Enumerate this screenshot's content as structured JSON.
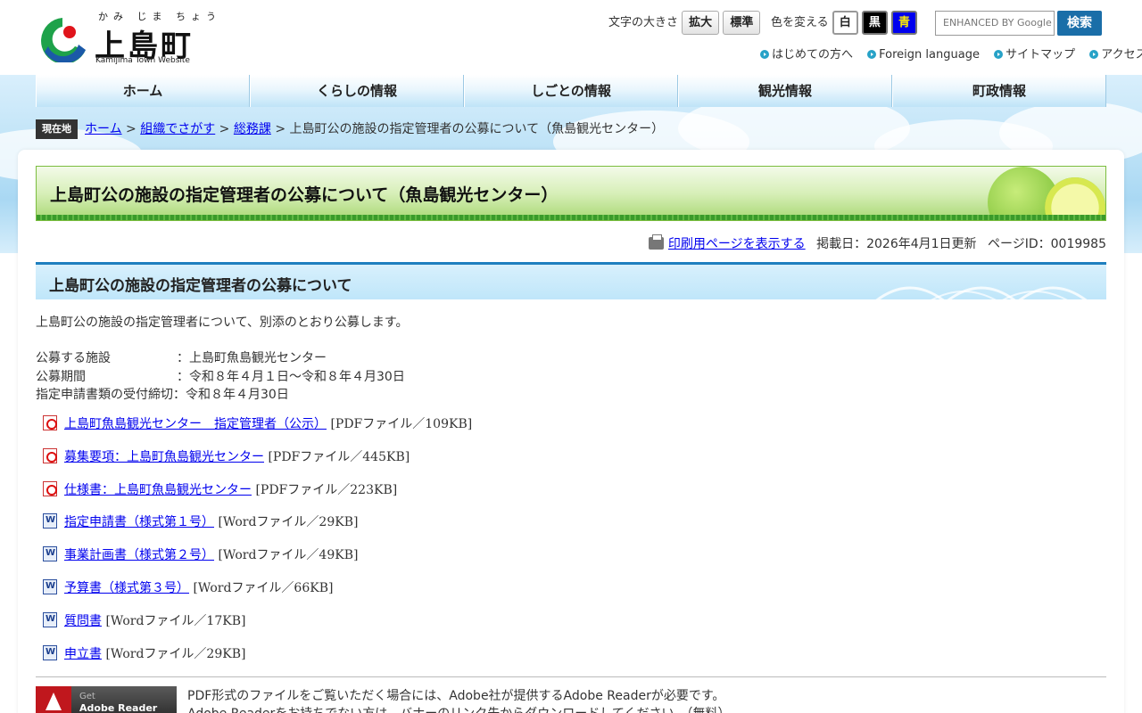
{
  "header": {
    "logo_ruby": "かみ じま ちょう",
    "logo_name": "上島町",
    "logo_sub": "Kamijima Town Website",
    "font_size_label": "文字の大きさ",
    "font_size_large": "拡大",
    "font_size_standard": "標準",
    "color_label": "色を変える",
    "color_white": "白",
    "color_black": "黒",
    "color_blue": "青",
    "search_placeholder": "ENHANCED BY Google",
    "search_button": "検索",
    "sublinks": [
      "はじめての方へ",
      "Foreign language",
      "サイトマップ",
      "アクセス"
    ]
  },
  "nav": [
    "ホーム",
    "くらしの情報",
    "しごとの情報",
    "観光情報",
    "町政情報"
  ],
  "breadcrumb": {
    "label": "現在地",
    "links": [
      "ホーム",
      "組織でさがす",
      "総務課"
    ],
    "separator": " > ",
    "current": "上島町公の施設の指定管理者の公募について（魚島観光センター）"
  },
  "page": {
    "title": "上島町公の施設の指定管理者の公募について（魚島観光センター）",
    "print_link": "印刷用ページを表示する",
    "published": "掲載日：2026年4月1日更新",
    "page_id": "ページID：0019985",
    "section_heading": "上島町公の施設の指定管理者の公募について",
    "intro": "上島町公の施設の指定管理者について、別添のとおり公募します。",
    "details": [
      {
        "label": "公募する施設",
        "value": "：上島町魚島観光センター"
      },
      {
        "label": "公募期間",
        "value": "：令和８年４月１日〜令和８年４月30日"
      },
      {
        "label": "指定申請書類の受付締切",
        "value": "：令和８年４月30日"
      }
    ],
    "files": [
      {
        "icon": "pdf-icon",
        "name": "上島町魚島観光センター　指定管理者（公示）",
        "type": "[PDFファイル／109KB]"
      },
      {
        "icon": "pdf-icon",
        "name": "募集要項：上島町魚島観光センター",
        "type": "[PDFファイル／445KB]"
      },
      {
        "icon": "pdf-icon",
        "name": "仕様書：上島町魚島観光センター",
        "type": "[PDFファイル／223KB]"
      },
      {
        "icon": "word-icon",
        "name": "指定申請書（様式第１号）",
        "type": "[Wordファイル／29KB]"
      },
      {
        "icon": "word-icon",
        "name": "事業計画書（様式第２号）",
        "type": "[Wordファイル／49KB]"
      },
      {
        "icon": "word-icon",
        "name": "予算書（様式第３号）",
        "type": "[Wordファイル／66KB]"
      },
      {
        "icon": "word-icon",
        "name": "質問書",
        "type": "[Wordファイル／17KB]"
      },
      {
        "icon": "word-icon",
        "name": "申立書",
        "type": "[Wordファイル／29KB]"
      }
    ],
    "adobe_banner": {
      "line1": "Get",
      "line2": "Adobe Reader"
    },
    "adobe_note_1": "PDF形式のファイルをご覧いただく場合には、Adobe社が提供するAdobe Readerが必要です。",
    "adobe_note_2": "Adobe Readerをお持ちでない方は、バナーのリンク先からダウンロードしてください。（無料）"
  },
  "colors": {
    "accent_blue": "#1e7fbf",
    "title_green": "#7bbd3f",
    "link": "#0000ee"
  }
}
